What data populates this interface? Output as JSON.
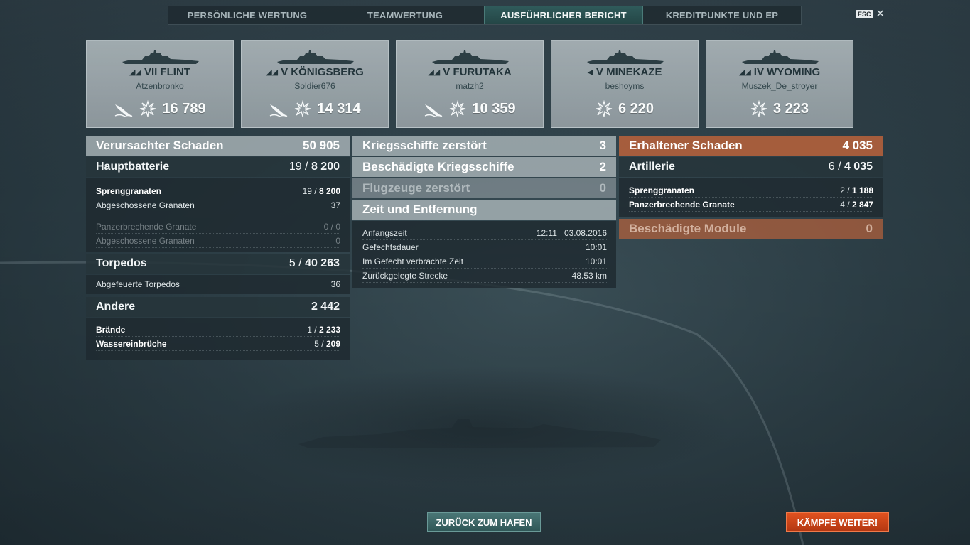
{
  "tabs": [
    {
      "label": "PERSÖNLICHE WERTUNG",
      "active": false
    },
    {
      "label": "TEAMWERTUNG",
      "active": false
    },
    {
      "label": "AUSFÜHRLICHER BERICHT",
      "active": true
    },
    {
      "label": "KREDITPUNKTE UND EP",
      "active": false
    }
  ],
  "esc": {
    "key": "ESC",
    "close": "✕"
  },
  "ships": [
    {
      "class_icon": "battleship-icon",
      "name": "VII FLINT",
      "player": "Atzenbronko",
      "sunk_icon": true,
      "damage": "16 789"
    },
    {
      "class_icon": "cruiser-icon",
      "name": "V KÖNIGSBERG",
      "player": "Soldier676",
      "sunk_icon": true,
      "damage": "14 314"
    },
    {
      "class_icon": "cruiser-icon",
      "name": "V FURUTAKA",
      "player": "matzh2",
      "sunk_icon": true,
      "damage": "10 359"
    },
    {
      "class_icon": "destroyer-icon",
      "name": "V MINEKAZE",
      "player": "beshoyms",
      "sunk_icon": false,
      "damage": "6 220"
    },
    {
      "class_icon": "battleship-icon",
      "name": "IV WYOMING",
      "player": "Muszek_De_stroyer",
      "sunk_icon": false,
      "damage": "3 223"
    }
  ],
  "left": {
    "total": {
      "label": "Verursachter Schaden",
      "value": "50 905"
    },
    "main_battery": {
      "label": "Hauptbatterie",
      "hits": "19 / ",
      "dmg": "8 200",
      "he": {
        "label": "Sprenggranaten",
        "hits": "19 / ",
        "dmg": "8 200"
      },
      "he_fired": {
        "label": "Abgeschossene Granaten",
        "value": "37"
      },
      "ap": {
        "label": "Panzerbrechende Granate",
        "value": "0 / 0"
      },
      "ap_fired": {
        "label": "Abgeschossene Granaten",
        "value": "0"
      }
    },
    "torpedos": {
      "label": "Torpedos",
      "hits": "5 / ",
      "dmg": "40 263",
      "fired": {
        "label": "Abgefeuerte Torpedos",
        "value": "36"
      }
    },
    "other": {
      "label": "Andere",
      "value": "2 442",
      "fires": {
        "label": "Brände",
        "hits": "1 / ",
        "dmg": "2 233"
      },
      "flooding": {
        "label": "Wassereinbrüche",
        "hits": "5 / ",
        "dmg": "209"
      }
    }
  },
  "middle": {
    "destroyed": {
      "label": "Kriegsschiffe zerstört",
      "value": "3"
    },
    "damaged": {
      "label": "Beschädigte Kriegsschiffe",
      "value": "2"
    },
    "planes": {
      "label": "Flugzeuge zerstört",
      "value": "0"
    },
    "time_header": "Zeit und Entfernung",
    "start": {
      "label": "Anfangszeit",
      "value": "12:11   03.08.2016"
    },
    "duration": {
      "label": "Gefechtsdauer",
      "value": "10:01"
    },
    "combat_time": {
      "label": "Im Gefecht verbrachte Zeit",
      "value": "10:01"
    },
    "distance": {
      "label": "Zurückgelegte Strecke",
      "value": "48.53 km"
    }
  },
  "right": {
    "received": {
      "label": "Erhaltener Schaden",
      "value": "4 035"
    },
    "artillery": {
      "label": "Artillerie",
      "hits": "6 / ",
      "dmg": "4 035"
    },
    "he": {
      "label": "Sprenggranaten",
      "hits": "2 / ",
      "dmg": "1 188"
    },
    "ap": {
      "label": "Panzerbrechende Granate",
      "hits": "4 / ",
      "dmg": "2 847"
    },
    "modules": {
      "label": "Beschädigte Module",
      "value": "0"
    }
  },
  "buttons": {
    "port": "ZURÜCK ZUM HAFEN",
    "fight": "KÄMPFE WEITER!"
  },
  "colors": {
    "accent_tab": "#2f5a5a",
    "received_panel": "#b0603c",
    "fight_button": "#d5461a",
    "port_button": "#3f6a6a"
  }
}
